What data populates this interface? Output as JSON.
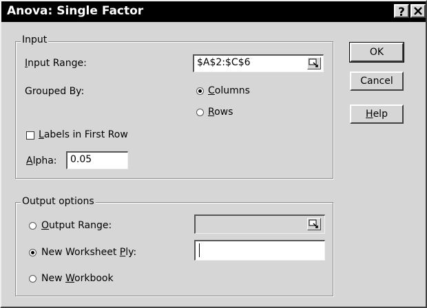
{
  "window": {
    "title": "Anova: Single Factor",
    "help_glyph": "?",
    "close_glyph": "✕"
  },
  "input": {
    "legend": "Input",
    "range_label_u": "I",
    "range_label_rest": "nput Range:",
    "range_value": "$A$2:$C$6",
    "grouped_label": "Grouped By:",
    "columns_u": "C",
    "columns_rest": "olumns",
    "rows_u": "R",
    "rows_rest": "ows",
    "grouped_selected": "Columns",
    "labels_u": "L",
    "labels_rest": "abels in First Row",
    "labels_checked": false,
    "alpha_u": "A",
    "alpha_rest": "lpha:",
    "alpha_value": "0.05"
  },
  "output": {
    "legend": "Output options",
    "range_pre": "",
    "range_u": "O",
    "range_rest": "utput Range:",
    "range_value": "",
    "new_ply_pre": "New Worksheet ",
    "new_ply_u": "P",
    "new_ply_rest": "ly:",
    "new_ply_value": "",
    "new_book_pre": "New ",
    "new_book_u": "W",
    "new_book_rest": "orkbook",
    "selected": "New Worksheet Ply"
  },
  "buttons": {
    "ok": "OK",
    "cancel": "Cancel",
    "help_u": "H",
    "help_rest": "elp"
  }
}
